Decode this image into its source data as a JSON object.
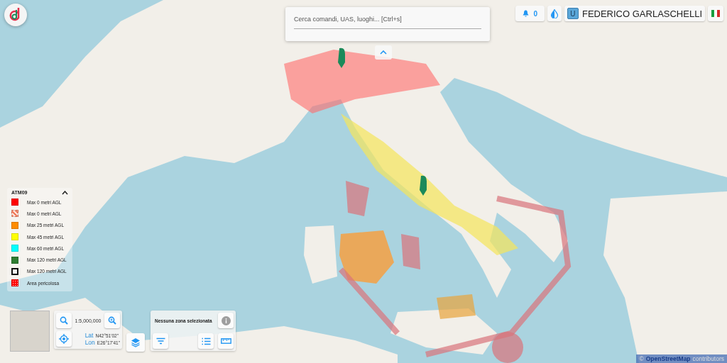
{
  "search": {
    "placeholder": "Cerca comandi, UAS, luoghi... [Ctrl+s]"
  },
  "notifications": {
    "count": "0"
  },
  "user": {
    "initial": "U",
    "name": "FEDERICO GARLASCHELLI"
  },
  "legend": {
    "title": "ATM09",
    "expanded": true,
    "items": [
      {
        "label": "Max 0 metri AGL",
        "color": "#ff0000",
        "kind": "solid"
      },
      {
        "label": "Max 0 metri AGL",
        "color": "#f07a5a",
        "kind": "hatched"
      },
      {
        "label": "Max 25 metri AGL",
        "color": "#ff8c00",
        "kind": "solid"
      },
      {
        "label": "Max 45 metri AGL",
        "color": "#ffff00",
        "kind": "solid"
      },
      {
        "label": "Max 60 metri AGL",
        "color": "#00ffff",
        "kind": "solid"
      },
      {
        "label": "Max 120 metri AGL",
        "color": "#2e7d32",
        "kind": "solid"
      },
      {
        "label": "Max 120 metri AGL",
        "color": "#111111",
        "kind": "outlined"
      },
      {
        "label": "Area pericolosa",
        "color": "#ff0000",
        "kind": "dotted"
      }
    ]
  },
  "map_controls": {
    "scale": "1:5,000,000",
    "lat_label": "Lat",
    "lat": "N42°51'02\"",
    "lon_label": "Lon",
    "lon": "E26°17'41\""
  },
  "zone_panel": {
    "message": "Nessuna zona selezionata"
  },
  "attribution": {
    "symbol": "©",
    "link": "OpenStreetMap",
    "text": "contributors"
  }
}
